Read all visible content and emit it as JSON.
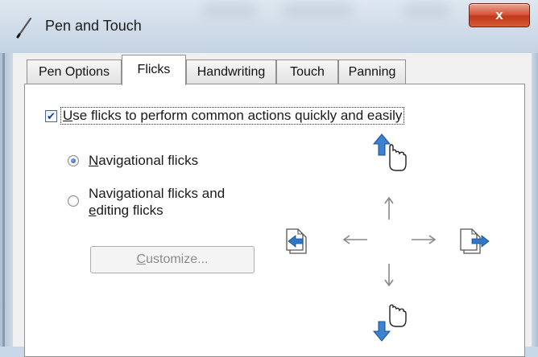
{
  "window": {
    "title": "Pen and Touch",
    "close_label": "x"
  },
  "tabs": [
    {
      "label": "Pen Options",
      "active": false
    },
    {
      "label": "Flicks",
      "active": true
    },
    {
      "label": "Handwriting",
      "active": false
    },
    {
      "label": "Touch",
      "active": false
    },
    {
      "label": "Panning",
      "active": false
    }
  ],
  "flicks": {
    "use_flicks": {
      "checked": true,
      "label_mnemonic": "U",
      "label_rest": "se flicks to perform common actions quickly and easily"
    },
    "mode_options": [
      {
        "mnemonic": "N",
        "rest": "avigational flicks",
        "checked": true
      },
      {
        "line1": "Navigational flicks and",
        "mnemonic": "e",
        "rest": "diting flicks",
        "checked": false
      }
    ],
    "customize_button": {
      "mnemonic": "C",
      "rest": "ustomize...",
      "enabled": false
    }
  },
  "icons": {
    "app": "pen-icon",
    "flick_up": "flick-up-hand-icon",
    "flick_down": "flick-down-hand-icon",
    "flick_left": "flick-left-page-icon",
    "flick_right": "flick-right-page-icon"
  },
  "colors": {
    "accent": "#2f78c6",
    "close_button": "#c9432a",
    "panel": "#ffffff"
  }
}
